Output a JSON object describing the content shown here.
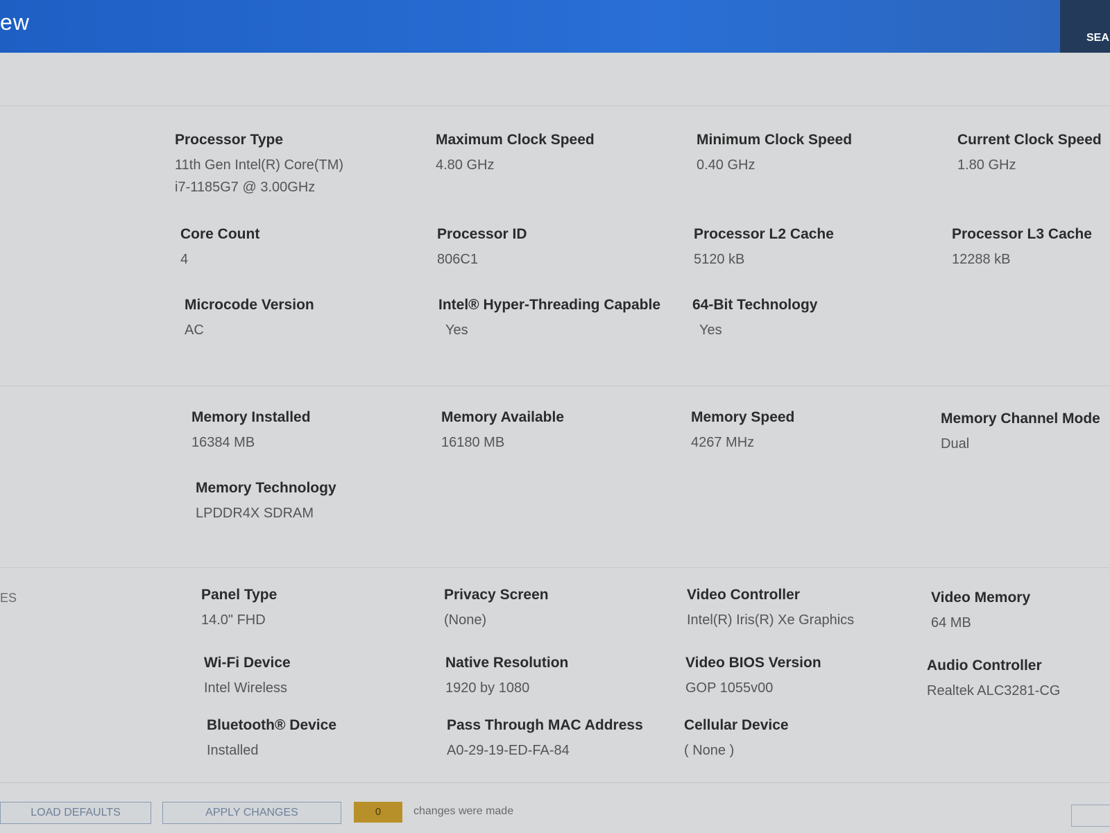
{
  "header": {
    "title": "ew",
    "search_label": "SEA"
  },
  "sections": {
    "display_label": "ES"
  },
  "processor": {
    "type_label": "Processor Type",
    "type_value_line1": "11th Gen Intel(R) Core(TM)",
    "type_value_line2": "i7-1185G7 @ 3.00GHz",
    "max_clock_label": "Maximum Clock Speed",
    "max_clock_value": "4.80 GHz",
    "min_clock_label": "Minimum Clock Speed",
    "min_clock_value": "0.40 GHz",
    "cur_clock_label": "Current Clock Speed",
    "cur_clock_value": "1.80 GHz",
    "core_count_label": "Core Count",
    "core_count_value": "4",
    "id_label": "Processor ID",
    "id_value": "806C1",
    "l2_label": "Processor L2 Cache",
    "l2_value": "5120 kB",
    "l3_label": "Processor L3 Cache",
    "l3_value": "12288 kB",
    "microcode_label": "Microcode Version",
    "microcode_value": "AC",
    "ht_label": "Intel® Hyper-Threading Capable",
    "ht_value": "Yes",
    "bit64_label": "64-Bit Technology",
    "bit64_value": "Yes"
  },
  "memory": {
    "installed_label": "Memory Installed",
    "installed_value": "16384 MB",
    "available_label": "Memory Available",
    "available_value": "16180 MB",
    "speed_label": "Memory Speed",
    "speed_value": "4267 MHz",
    "channel_label": "Memory Channel Mode",
    "channel_value": "Dual",
    "tech_label": "Memory Technology",
    "tech_value": "LPDDR4X SDRAM"
  },
  "devices": {
    "panel_label": "Panel Type",
    "panel_value": "14.0\" FHD",
    "privacy_label": "Privacy Screen",
    "privacy_value": "(None)",
    "video_ctrl_label": "Video Controller",
    "video_ctrl_value": "Intel(R) Iris(R) Xe Graphics",
    "video_mem_label": "Video Memory",
    "video_mem_value": "64 MB",
    "wifi_label": "Wi-Fi Device",
    "wifi_value": "Intel Wireless",
    "native_res_label": "Native Resolution",
    "native_res_value": "1920 by 1080",
    "vbios_label": "Video BIOS Version",
    "vbios_value": "GOP 1055v00",
    "audio_label": "Audio Controller",
    "audio_value": "Realtek ALC3281-CG",
    "bt_label": "Bluetooth® Device",
    "bt_value": "Installed",
    "mac_label": "Pass Through MAC Address",
    "mac_value": "A0-29-19-ED-FA-84",
    "cellular_label": "Cellular Device",
    "cellular_value": "( None )"
  },
  "footer": {
    "load_defaults": "LOAD DEFAULTS",
    "apply_changes": "APPLY CHANGES",
    "change_count": "0",
    "changes_text": "changes were made"
  }
}
